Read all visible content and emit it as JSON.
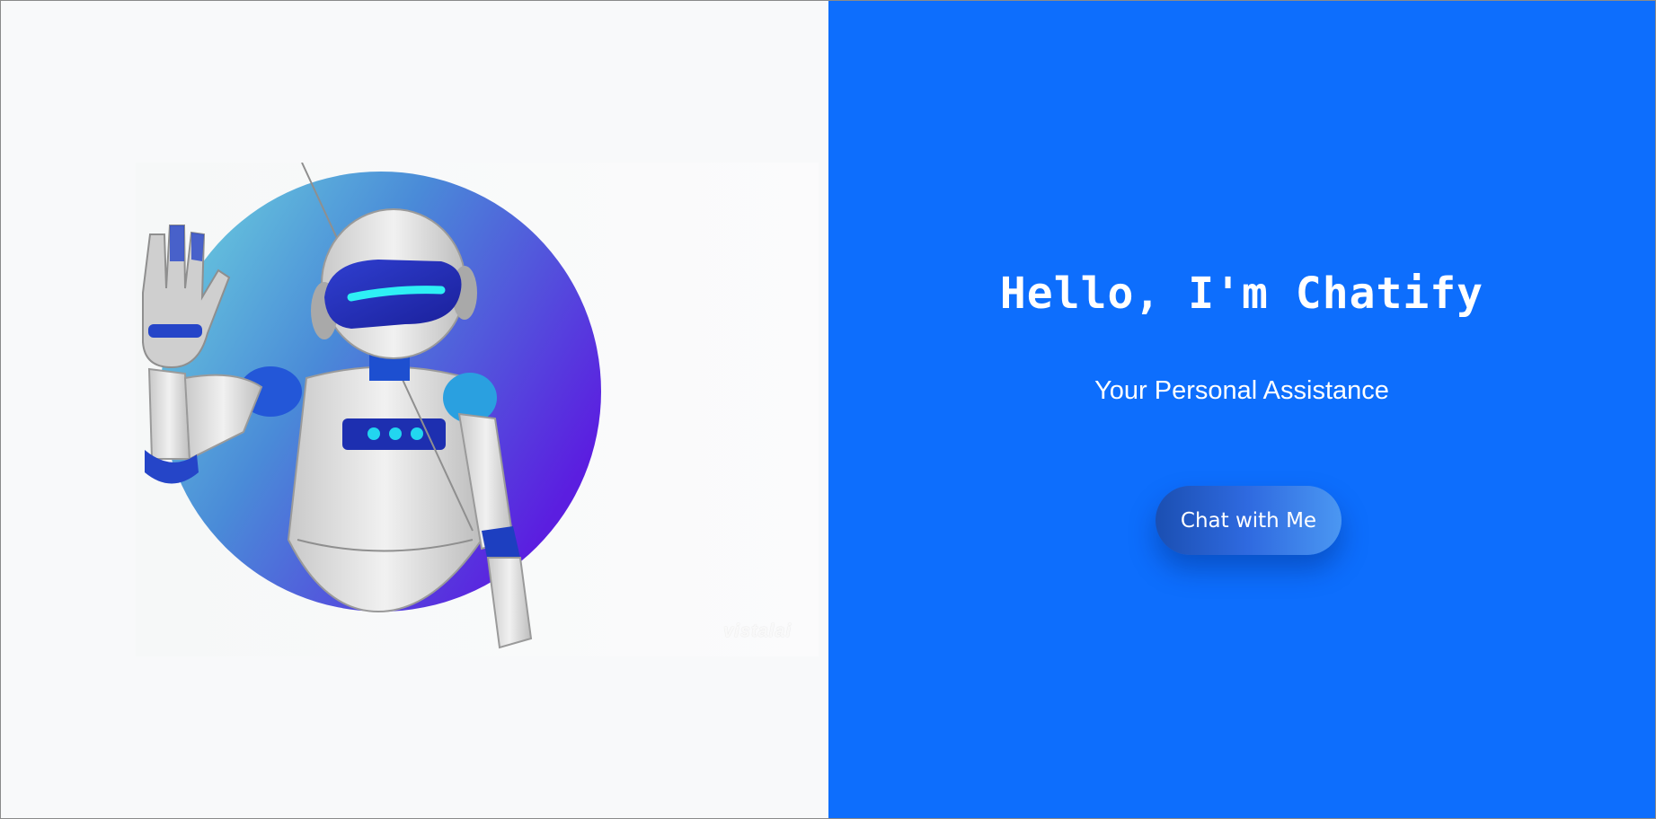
{
  "hero": {
    "title": "Hello, I'm Chatify",
    "subtitle": "Your Personal Assistance",
    "cta_label": "Chat with Me"
  },
  "image": {
    "subject": "waving-robot-illustration",
    "watermark": "vistalai"
  },
  "colors": {
    "right_panel_bg": "#0d6efd",
    "left_panel_bg": "#f8f9fa",
    "button_gradient_start": "#1b4fb2",
    "button_gradient_end": "#4b97f2",
    "circle_gradient_start": "#6fd6de",
    "circle_gradient_end": "#5b1ee0"
  }
}
